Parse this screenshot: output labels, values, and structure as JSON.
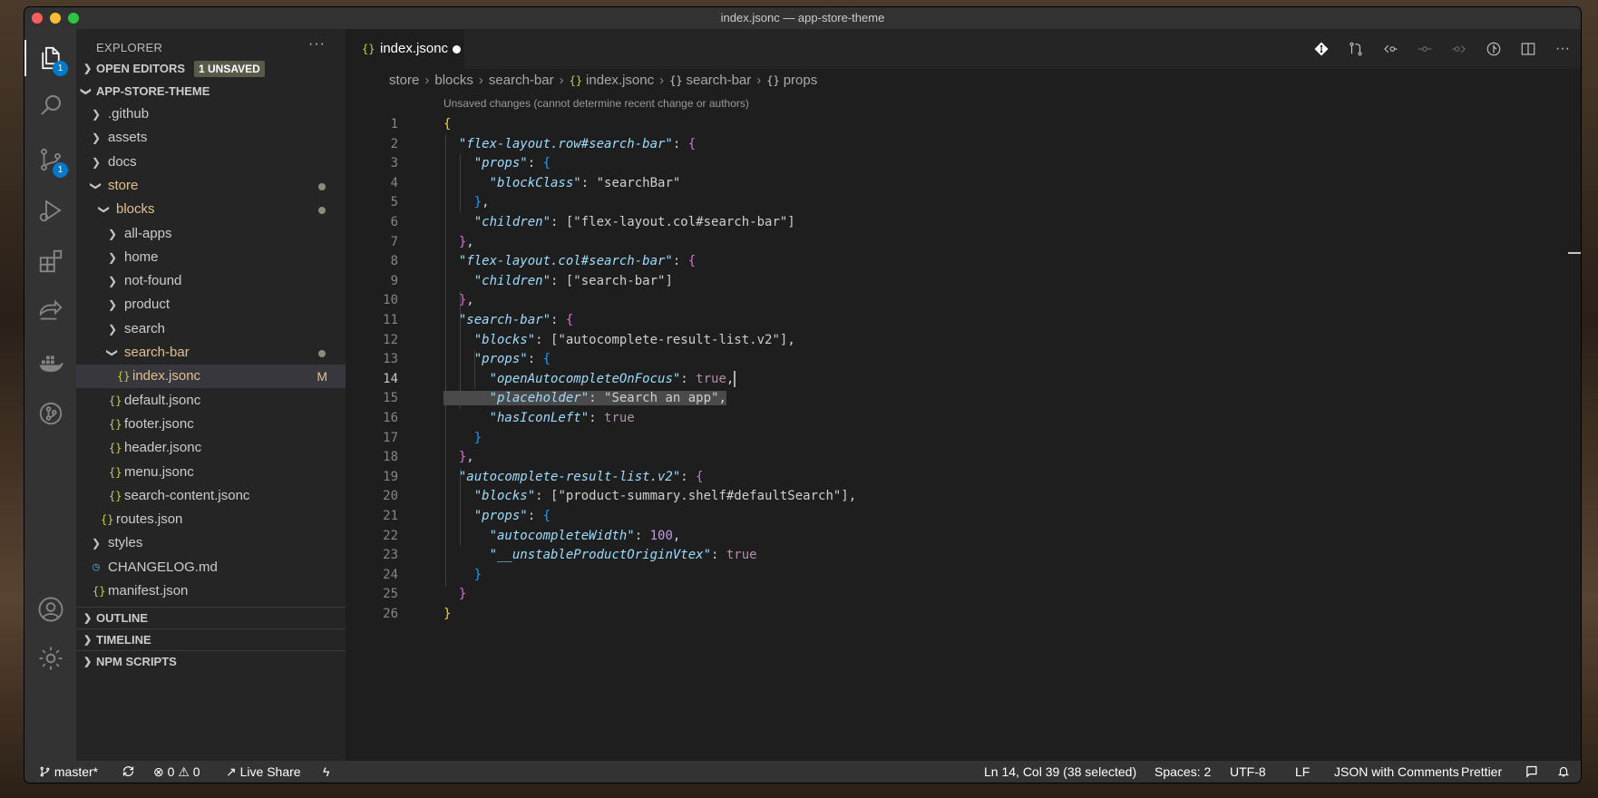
{
  "window": {
    "title": "index.jsonc — app-store-theme"
  },
  "activity_bar": {
    "items": [
      {
        "name": "explorer-icon",
        "badge": "1"
      },
      {
        "name": "search-icon"
      },
      {
        "name": "source-control-icon",
        "badge": "1"
      },
      {
        "name": "run-debug-icon"
      },
      {
        "name": "extensions-icon"
      },
      {
        "name": "live-share-icon"
      },
      {
        "name": "docker-icon"
      },
      {
        "name": "gitlens-icon"
      }
    ],
    "bottom": [
      {
        "name": "accounts-icon"
      },
      {
        "name": "manage-gear-icon"
      }
    ]
  },
  "sidebar": {
    "title": "EXPLORER",
    "more": "···",
    "open_editors": {
      "label": "OPEN EDITORS",
      "badge": "1 UNSAVED"
    },
    "root": "APP-STORE-THEME",
    "tree": [
      {
        "label": ".github",
        "type": "folder",
        "depth": 1,
        "open": false
      },
      {
        "label": "assets",
        "type": "folder",
        "depth": 1,
        "open": false
      },
      {
        "label": "docs",
        "type": "folder",
        "depth": 1,
        "open": false
      },
      {
        "label": "store",
        "type": "folder",
        "depth": 1,
        "open": true,
        "modified": true
      },
      {
        "label": "blocks",
        "type": "folder",
        "depth": 2,
        "open": true,
        "modified": true
      },
      {
        "label": "all-apps",
        "type": "folder",
        "depth": 3,
        "open": false
      },
      {
        "label": "home",
        "type": "folder",
        "depth": 3,
        "open": false
      },
      {
        "label": "not-found",
        "type": "folder",
        "depth": 3,
        "open": false
      },
      {
        "label": "product",
        "type": "folder",
        "depth": 3,
        "open": false
      },
      {
        "label": "search",
        "type": "folder",
        "depth": 3,
        "open": false
      },
      {
        "label": "search-bar",
        "type": "folder",
        "depth": 3,
        "open": true,
        "modified": true
      },
      {
        "label": "index.jsonc",
        "type": "json",
        "depth": 4,
        "selected": true,
        "mark": "M"
      },
      {
        "label": "default.jsonc",
        "type": "json",
        "depth": 3
      },
      {
        "label": "footer.jsonc",
        "type": "json",
        "depth": 3
      },
      {
        "label": "header.jsonc",
        "type": "json",
        "depth": 3
      },
      {
        "label": "menu.jsonc",
        "type": "json",
        "depth": 3
      },
      {
        "label": "search-content.jsonc",
        "type": "json",
        "depth": 3
      },
      {
        "label": "routes.json",
        "type": "json",
        "depth": 2
      },
      {
        "label": "styles",
        "type": "folder",
        "depth": 1,
        "open": false
      },
      {
        "label": "CHANGELOG.md",
        "type": "md",
        "depth": 1
      },
      {
        "label": "manifest.json",
        "type": "json",
        "depth": 1
      }
    ],
    "bottom_sections": [
      "OUTLINE",
      "TIMELINE",
      "NPM SCRIPTS"
    ]
  },
  "editor": {
    "tab": {
      "label": "index.jsonc",
      "icon": "{}",
      "unsaved": true
    },
    "breadcrumb": [
      "store",
      "blocks",
      "search-bar",
      "index.jsonc",
      "search-bar",
      "props"
    ],
    "codelens": "Unsaved changes (cannot determine recent change or authors)",
    "lines": [
      "1",
      "2",
      "3",
      "4",
      "5",
      "6",
      "7",
      "8",
      "9",
      "10",
      "11",
      "12",
      "13",
      "14",
      "15",
      "16",
      "17",
      "18",
      "19",
      "20",
      "21",
      "22",
      "23",
      "24",
      "25",
      "26"
    ],
    "code": {
      "k_flex_row": "\"flex-layout.row#search-bar\"",
      "k_props": "\"props\"",
      "k_blockClass": "\"blockClass\"",
      "v_searchBar": "\"searchBar\"",
      "k_children": "\"children\"",
      "v_flex_col_arr": "[\"flex-layout.col#search-bar\"]",
      "k_flex_col": "\"flex-layout.col#search-bar\"",
      "v_search_bar_arr": "[\"search-bar\"]",
      "k_search_bar": "\"search-bar\"",
      "k_blocks": "\"blocks\"",
      "v_autocomplete_arr": "[\"autocomplete-result-list.v2\"]",
      "k_openAuto": "\"openAutocompleteOnFocus\"",
      "v_true": "true",
      "k_placeholder": "\"placeholder\"",
      "v_placeholder": "\"Search an app\"",
      "k_hasIconLeft": "\"hasIconLeft\"",
      "k_autocomplete": "\"autocomplete-result-list.v2\"",
      "v_product_arr": "[\"product-summary.shelf#defaultSearch\"]",
      "k_autoWidth": "\"autocompleteWidth\"",
      "v_100": "100",
      "k_unstable": "\"__unstableProductOriginVtex\""
    }
  },
  "statusbar": {
    "branch": "master*",
    "errors": "0",
    "warnings": "0",
    "live_share": "Live Share",
    "position": "Ln 14, Col 39 (38 selected)",
    "spaces": "Spaces: 2",
    "encoding": "UTF-8",
    "eol": "LF",
    "language": "JSON with Comments",
    "formatter": "Prettier"
  },
  "colors": {
    "accent": "#007acc",
    "modified": "#e2c08d",
    "bracket_gold": "#ffd700",
    "bracket_orchid": "#da70d6",
    "bracket_blue": "#179fff",
    "key": "#9cdcfe"
  }
}
